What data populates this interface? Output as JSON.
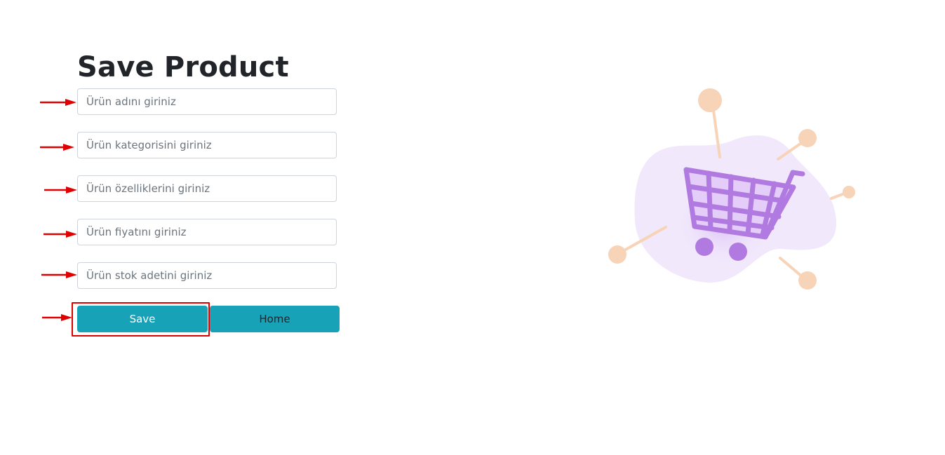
{
  "page": {
    "title": "Save Product"
  },
  "form": {
    "fields": [
      {
        "name": "product-name-input",
        "placeholder": "Ürün adını giriniz",
        "value": ""
      },
      {
        "name": "product-category-input",
        "placeholder": "Ürün kategorisini giriniz",
        "value": ""
      },
      {
        "name": "product-features-input",
        "placeholder": "Ürün özelliklerini giriniz",
        "value": ""
      },
      {
        "name": "product-price-input",
        "placeholder": "Ürün fiyatını giriniz",
        "value": ""
      },
      {
        "name": "product-stock-input",
        "placeholder": "Ürün stok adetini giriniz",
        "value": ""
      }
    ],
    "save_label": "Save",
    "home_label": "Home"
  },
  "colors": {
    "primary_button": "#17a2b8",
    "annotation_red": "#e00000",
    "cart_purple": "#b07ae0",
    "blob_lavender": "#f1e8fc",
    "node_peach": "#f7d3b8"
  },
  "icons": {
    "annotation": "red-arrow-icon",
    "illustration": "shopping-cart-icon"
  }
}
